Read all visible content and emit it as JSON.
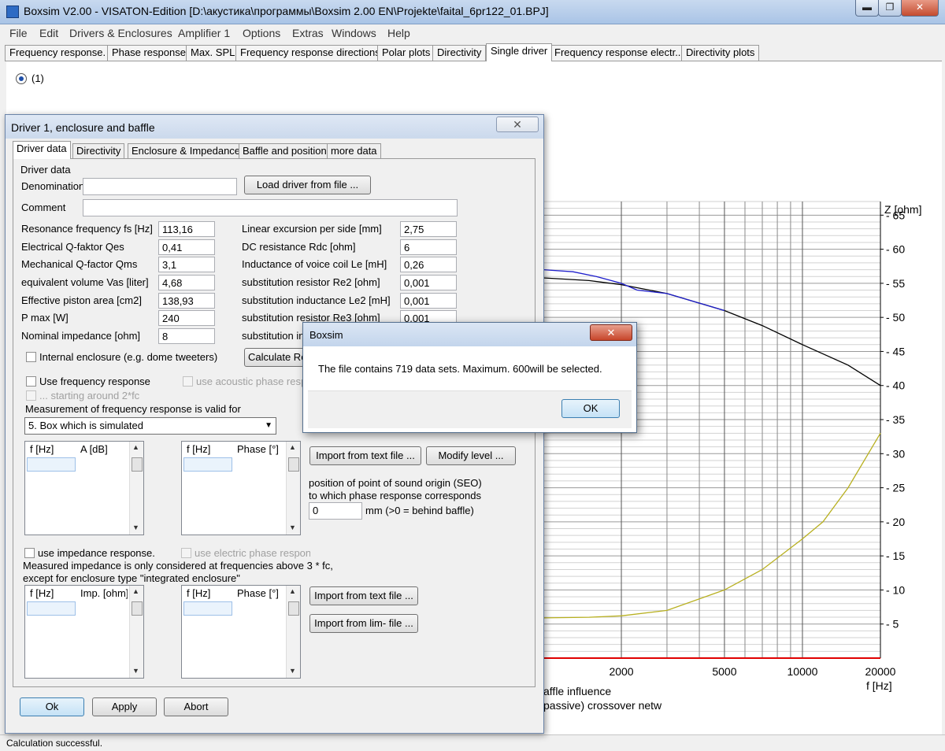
{
  "window": {
    "title": "Boxsim V2.00 - VISATON-Edition [D:\\акустика\\программы\\Boxsim 2.00 EN\\Projekte\\faital_6pr122_01.BPJ]",
    "min": "▬",
    "max": "❐",
    "close": "✕"
  },
  "menu": [
    "File",
    "Edit",
    "Drivers & Enclosures",
    "Amplifier 1",
    "Options",
    "Extras",
    "Windows",
    "Help"
  ],
  "tabs": [
    "Frequency response.",
    "Phase response",
    "Max. SPL",
    "Frequency response directions",
    "Polar plots",
    "Directivity",
    "Single driver",
    "Frequency response electr..",
    "Directivity plots"
  ],
  "active_tab": "Single driver",
  "radio_label": "(1)",
  "status": "Calculation successful.",
  "chart_data": {
    "type": "line",
    "xlabel": "f [Hz]",
    "ylabel": "Z [ohm]",
    "x_scale": "log",
    "xlim": [
      1000,
      20000
    ],
    "ylim": [
      0,
      67
    ],
    "x_ticks": [
      2000,
      5000,
      10000,
      20000
    ],
    "y_ticks": [
      5,
      10,
      15,
      20,
      25,
      30,
      35,
      40,
      45,
      50,
      55,
      60,
      65
    ],
    "grid": true,
    "legend_fragments": [
      "affle influence",
      "passive) crossover netw"
    ],
    "series": [
      {
        "color": "#000000",
        "x": [
          1000,
          1500,
          2000,
          3000,
          5000,
          7000,
          10000,
          15000,
          20000
        ],
        "y": [
          55.8,
          55.4,
          54.8,
          53.5,
          51.0,
          48.8,
          46.0,
          43.0,
          40.0
        ]
      },
      {
        "color": "#1f1fcc",
        "x": [
          1000,
          1300,
          1600,
          2000,
          2300,
          3000,
          5000
        ],
        "y": [
          57.0,
          56.7,
          56.0,
          55.0,
          54.0,
          53.5,
          51.0
        ]
      },
      {
        "color": "#b8b020",
        "x": [
          1000,
          1500,
          2000,
          3000,
          5000,
          7000,
          10000,
          12000,
          15000,
          20000
        ],
        "y": [
          5.9,
          6.0,
          6.2,
          7.0,
          10.0,
          13.0,
          17.5,
          20.0,
          25.0,
          33.0
        ]
      },
      {
        "color": "#e00000",
        "x": [
          1000,
          20000
        ],
        "y": [
          0,
          0
        ]
      }
    ]
  },
  "dialog": {
    "title": "Driver 1, enclosure and baffle",
    "close": "✕",
    "tabs": [
      "Driver data",
      "Directivity",
      "Enclosure & Impedance",
      "Baffle and position",
      "more data"
    ],
    "group_title": "Driver data",
    "denomination_label": "Denomination",
    "denomination_value": "",
    "load_button": "Load driver from file ...",
    "comment_label": "Comment",
    "comment_value": "",
    "left_params": [
      {
        "label": "Resonance frequency fs [Hz]",
        "value": "113,16"
      },
      {
        "label": "Electrical Q-faktor Qes",
        "value": "0,41"
      },
      {
        "label": "Mechanical Q-factor Qms",
        "value": "3,1"
      },
      {
        "label": "equivalent volume Vas [liter]",
        "value": "4,68"
      },
      {
        "label": "Effective piston area [cm2]",
        "value": "138,93"
      },
      {
        "label": "P max [W]",
        "value": "240"
      },
      {
        "label": "Nominal impedance [ohm]",
        "value": "8"
      }
    ],
    "right_params": [
      {
        "label": "Linear excursion per side [mm]",
        "value": "2,75"
      },
      {
        "label": "DC resistance Rdc [ohm]",
        "value": "6"
      },
      {
        "label": "Inductance of voice coil Le [mH]",
        "value": "0,26"
      },
      {
        "label": "substitution resistor Re2 [ohm]",
        "value": "0,001"
      },
      {
        "label": "substitution inductance Le2 [mH]",
        "value": "0,001"
      },
      {
        "label": "substitution resistor Re3 [ohm]",
        "value": "0,001"
      },
      {
        "label": "substitution in",
        "value": ""
      }
    ],
    "internal_enclosure": "Internal enclosure (e.g. dome tweeters)",
    "calculate_button": "Calculate Re...",
    "use_freq_response": "Use frequency response",
    "use_acoustic_phase": "use acoustic phase resp.",
    "starting_around": "... starting around 2*fc",
    "measurement_valid_for": "Measurement of frequency response is valid for",
    "box_option": "5. Box which is simulated",
    "freq_grid_cols": [
      "f [Hz]",
      "A [dB]"
    ],
    "phase_grid_cols": [
      "f [Hz]",
      "Phase [°]"
    ],
    "import_text_button": "Import from text file ...",
    "modify_level_button": "Modify level ...",
    "seo_line1": "position of point of sound origin (SEO)",
    "seo_line2": "to which phase response corresponds",
    "seo_value": "0",
    "seo_unit": "mm (>0 = behind baffle)",
    "use_impedance": "use impedance response.",
    "use_electric_phase": "use electric phase response",
    "imp_note1": "Measured impedance is only considered at frequencies above 3 * fc,",
    "imp_note2": "except for enclosure type \"integrated enclosure\"",
    "imp_grid_cols": [
      "f [Hz]",
      "Imp. [ohm]"
    ],
    "imp_phase_grid_cols": [
      "f [Hz]",
      "Phase [°]"
    ],
    "import_text_button2": "Import from text file ...",
    "import_lim_button": "Import from lim- file ...",
    "ok_button": "Ok",
    "apply_button": "Apply",
    "abort_button": "Abort"
  },
  "msgbox": {
    "title": "Boxsim",
    "close": "✕",
    "text": "The file contains 719 data sets. Maximum. 600will be selected.",
    "ok": "OK"
  }
}
